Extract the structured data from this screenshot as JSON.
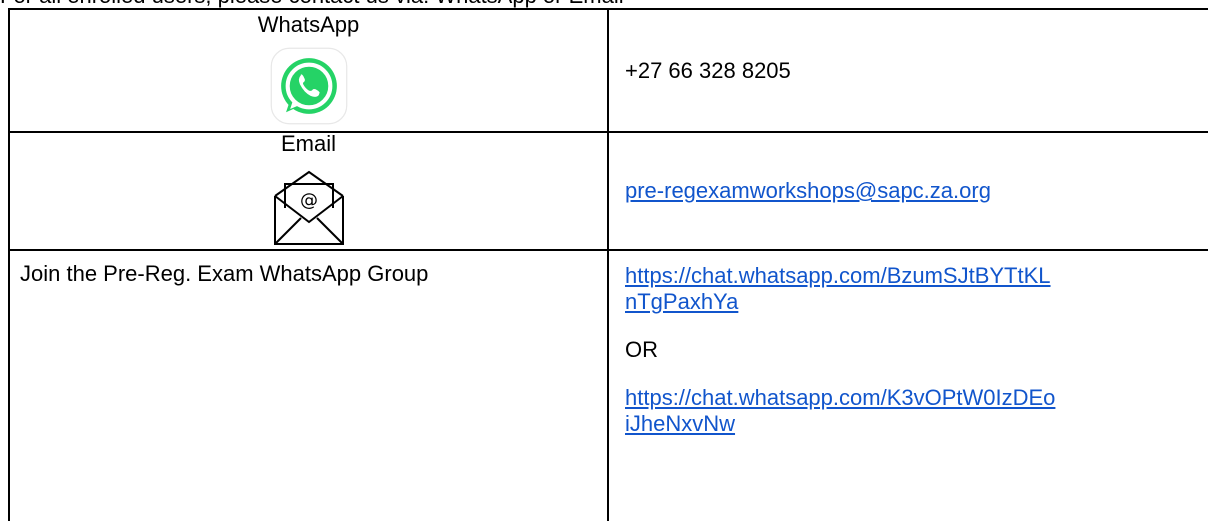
{
  "header_fragment": "For all enrolled users, please contact us via: WhatsApp or Email",
  "rows": [
    {
      "label": "WhatsApp",
      "value": "+27 66 328 8205",
      "icon": "whatsapp-logo-icon"
    },
    {
      "label": "Email",
      "value": "pre-regexamworkshops@sapc.za.org",
      "icon": "envelope-at-icon"
    },
    {
      "label": "Join the Pre-Reg. Exam WhatsApp Group",
      "link1_line1": "https://chat.whatsapp.com/BzumSJtBYTtKL",
      "link1_line2": "nTgPaxhYa",
      "separator": "OR",
      "link2_line1": "https://chat.whatsapp.com/K3vOPtW0IzDEo",
      "link2_line2": "iJheNxvNw"
    }
  ],
  "colors": {
    "link": "#1155cc",
    "whatsapp_green": "#25d366"
  }
}
